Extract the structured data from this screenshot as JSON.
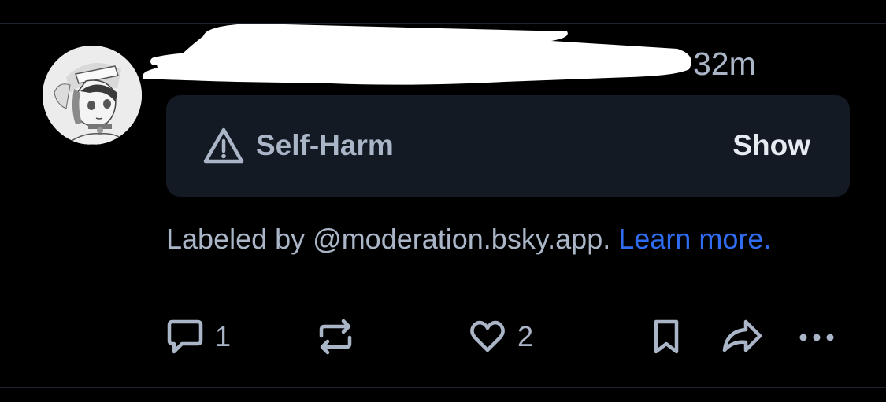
{
  "post": {
    "timestamp": "32m",
    "content_warning": {
      "icon": "warning-triangle-icon",
      "label": "Self-Harm",
      "action": "Show"
    },
    "label_notice": {
      "text": "Labeled by @moderation.bsky.app.",
      "link": "Learn more."
    },
    "actions": {
      "reply": {
        "icon": "reply-icon",
        "count": "1"
      },
      "repost": {
        "icon": "repost-icon"
      },
      "like": {
        "icon": "heart-icon",
        "count": "2"
      },
      "bookmark": {
        "icon": "bookmark-icon"
      },
      "share": {
        "icon": "share-icon"
      },
      "more": {
        "icon": "more-icon"
      }
    }
  },
  "colors": {
    "background": "#000000",
    "card": "#141a23",
    "text": "#aab6c8",
    "link": "#2f6cf0"
  }
}
